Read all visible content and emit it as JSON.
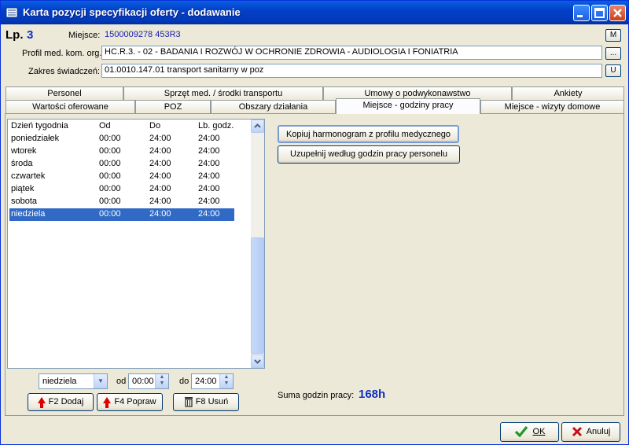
{
  "window": {
    "title": "Karta pozycji specyfikacji oferty - dodawanie"
  },
  "header": {
    "lp_label": "Lp.",
    "lp_value": "3",
    "miejsce_label": "Miejsce:",
    "miejsce_value": "1500009278 453R3",
    "miejsce_btn": "M",
    "profil_label": "Profil med. kom. org.:",
    "profil_value": "HC.R.3. - 02 - BADANIA I ROZWÓJ W OCHRONIE ZDROWIA - AUDIOLOGIA I FONIATRIA",
    "profil_btn": "...",
    "zakres_label": "Zakres świadczeń:",
    "zakres_value": "01.0010.147.01 transport sanitarny w  poz",
    "zakres_btn": "U"
  },
  "tabs_row1": [
    "Personel",
    "Sprzęt med. / środki transportu",
    "Umowy o podwykonawstwo",
    "Ankiety"
  ],
  "tabs_row2": [
    "Wartości oferowane",
    "POZ",
    "Obszary działania",
    "Miejsce - godziny pracy",
    "Miejsce - wizyty domowe"
  ],
  "active_tab": "Miejsce - godziny pracy",
  "schedule": {
    "columns": [
      "Dzień tygodnia",
      "Od",
      "Do",
      "Lb. godz."
    ],
    "rows": [
      [
        "poniedziałek",
        "00:00",
        "24:00",
        "24:00"
      ],
      [
        "wtorek",
        "00:00",
        "24:00",
        "24:00"
      ],
      [
        "środa",
        "00:00",
        "24:00",
        "24:00"
      ],
      [
        "czwartek",
        "00:00",
        "24:00",
        "24:00"
      ],
      [
        "piątek",
        "00:00",
        "24:00",
        "24:00"
      ],
      [
        "sobota",
        "00:00",
        "24:00",
        "24:00"
      ],
      [
        "niedziela",
        "00:00",
        "24:00",
        "24:00"
      ]
    ],
    "selected_row": 6
  },
  "editor": {
    "day_value": "niedziela",
    "od_label": "od",
    "od_value": "00:00",
    "do_label": "do",
    "do_value": "24:00"
  },
  "actions": {
    "add": "F2 Dodaj",
    "edit": "F4 Popraw",
    "delete": "F8 Usuń",
    "copy_schedule": "Kopiuj harmonogram z profilu medycznego",
    "fill_staff": "Uzupełnij według godzin pracy personelu"
  },
  "summary": {
    "label": "Suma godzin pracy:",
    "value": "168h"
  },
  "footer": {
    "ok": "OK",
    "cancel": "Anuluj"
  },
  "colors": {
    "selection": "#316ac5",
    "summary_value": "#1030c0",
    "lp_value": "#1030c0"
  }
}
